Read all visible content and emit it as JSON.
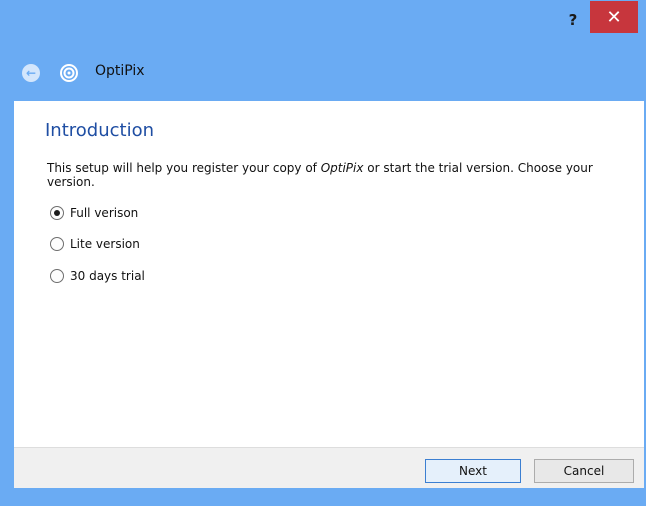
{
  "window": {
    "help_label": "?",
    "close_label": "✕"
  },
  "nav": {
    "back_icon": "back-arrow-icon",
    "app_icon": "optipix-target-icon",
    "app_title": "OptiPix"
  },
  "page": {
    "heading": "Introduction",
    "description_prefix": "This setup will help you register your copy of ",
    "description_product": "OptiPix",
    "description_suffix": " or start the trial version. Choose your version."
  },
  "options": [
    {
      "label": "Full verison",
      "checked": true
    },
    {
      "label": "Lite version",
      "checked": false
    },
    {
      "label": "30 days trial",
      "checked": false
    }
  ],
  "buttons": {
    "next": "Next",
    "cancel": "Cancel"
  },
  "colors": {
    "accent": "#6aabf3",
    "close": "#c7363d",
    "heading": "#1f4ea3"
  }
}
